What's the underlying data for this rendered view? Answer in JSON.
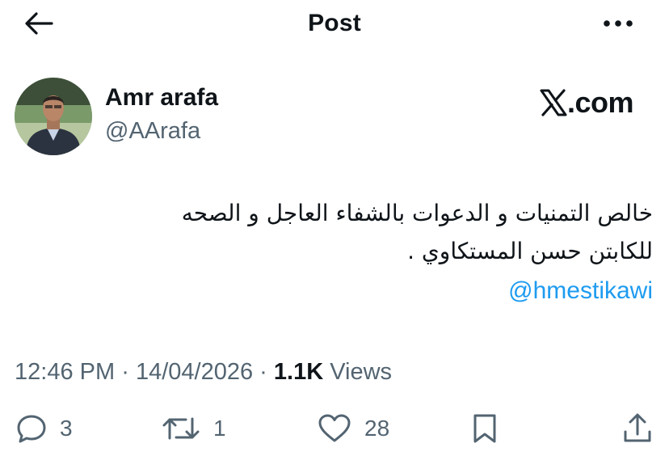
{
  "header": {
    "title": "Post",
    "back_icon": "arrow-left-icon",
    "more_icon": "more-horizontal-icon"
  },
  "author": {
    "display_name": "Amr arafa",
    "handle": "@AArafa"
  },
  "brand": {
    "text": ".com",
    "icon": "x-logo-icon"
  },
  "tweet": {
    "lines": [
      "خالص التمنيات و الدعوات بالشفاء العاجل  و الصحه",
      "للكابتن حسن المستكاوي ."
    ],
    "mention": "@hmestikawi"
  },
  "meta": {
    "time": "12:46 PM",
    "separator": "·",
    "date": "14/04/2026",
    "views_count": "1.1K",
    "views_label": "Views"
  },
  "actions": {
    "replies": "3",
    "reposts": "1",
    "likes": "28"
  },
  "colors": {
    "text": "#0f1419",
    "secondary": "#536471",
    "link": "#1d9bf0",
    "background": "#ffffff"
  }
}
